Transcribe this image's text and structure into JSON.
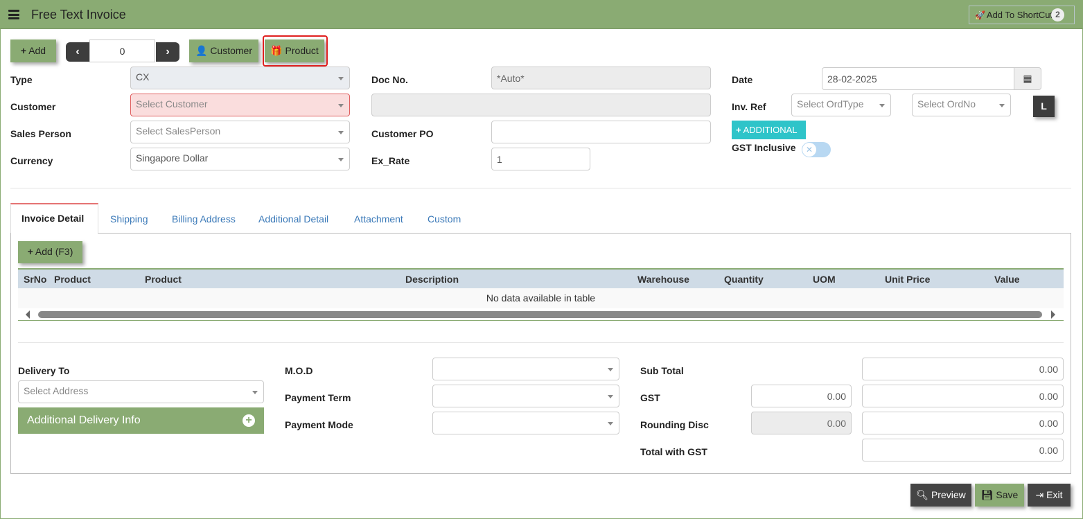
{
  "header": {
    "title": "Free Text Invoice",
    "shortcut_label": "Add To ShortCut",
    "shortcut_count": "2"
  },
  "toolbar": {
    "add_label": "Add",
    "record_number": "0",
    "customer_label": "Customer",
    "product_label": "Product"
  },
  "form": {
    "type_label": "Type",
    "type_value": "CX",
    "customer_label": "Customer",
    "customer_placeholder": "Select Customer",
    "sales_person_label": "Sales Person",
    "sales_person_placeholder": "Select SalesPerson",
    "currency_label": "Currency",
    "currency_value": "Singapore Dollar",
    "doc_no_label": "Doc No.",
    "doc_no_value": "*Auto*",
    "customer_po_label": "Customer PO",
    "ex_rate_label": "Ex_Rate",
    "ex_rate_value": "1",
    "date_label": "Date",
    "date_value": "28-02-2025",
    "inv_ref_label": "Inv. Ref",
    "ord_type_placeholder": "Select OrdType",
    "ord_no_placeholder": "Select OrdNo",
    "l_label": "L",
    "additional_label": "ADDITIONAL",
    "gst_inclusive_label": "GST Inclusive"
  },
  "tabs": [
    {
      "label": "Invoice Detail",
      "active": true
    },
    {
      "label": "Shipping"
    },
    {
      "label": "Billing Address"
    },
    {
      "label": "Additional Detail"
    },
    {
      "label": "Attachment"
    },
    {
      "label": "Custom"
    }
  ],
  "detail": {
    "add_label": "Add (F3)",
    "columns": [
      "SrNo",
      "Product",
      "Product",
      "Description",
      "Warehouse",
      "Quantity",
      "UOM",
      "Unit Price",
      "Value"
    ],
    "empty_message": "No data available in table"
  },
  "footer": {
    "delivery_to_label": "Delivery To",
    "address_placeholder": "Select Address",
    "additional_delivery_label": "Additional Delivery Info",
    "mod_label": "M.O.D",
    "payment_term_label": "Payment Term",
    "payment_mode_label": "Payment Mode",
    "sub_total_label": "Sub Total",
    "sub_total_value": "0.00",
    "gst_label": "GST",
    "gst_rate_value": "0.00",
    "gst_value": "0.00",
    "rounding_label": "Rounding Disc",
    "rounding_rate_value": "0.00",
    "rounding_value": "0.00",
    "total_label": "Total with GST",
    "total_value": "0.00"
  },
  "actions": {
    "preview_label": "Preview",
    "save_label": "Save",
    "exit_label": "Exit"
  },
  "colors": {
    "accent": "#8aab73",
    "dark": "#3d3d3d",
    "teal": "#2ec4c9",
    "error": "#e02020"
  }
}
